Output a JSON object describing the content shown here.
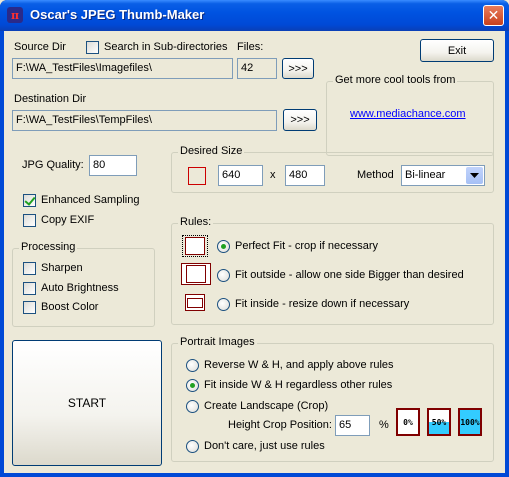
{
  "window": {
    "title": "Oscar's JPEG Thumb-Maker",
    "close_symbol": "✕"
  },
  "source": {
    "label": "Source Dir",
    "search_sub_label": "Search in Sub-directories",
    "search_sub_checked": false,
    "path": "F:\\WA_TestFiles\\Imagefiles\\",
    "files_label": "Files:",
    "files_count": "42",
    "browse_label": ">>>"
  },
  "destination": {
    "label": "Destination Dir",
    "path": "F:\\WA_TestFiles\\TempFiles\\",
    "browse_label": ">>>"
  },
  "exit_label": "Exit",
  "tools": {
    "text": "Get more cool tools from",
    "link": "www.mediachance.com"
  },
  "quality": {
    "label": "JPG Quality:",
    "value": "80"
  },
  "options": {
    "enhanced_label": "Enhanced Sampling",
    "enhanced_checked": true,
    "copy_exif_label": "Copy EXIF",
    "copy_exif_checked": false
  },
  "processing": {
    "title": "Processing",
    "sharpen_label": "Sharpen",
    "auto_brightness_label": "Auto Brightness",
    "boost_color_label": "Boost Color"
  },
  "desired_size": {
    "title": "Desired Size",
    "width": "640",
    "x_label": "x",
    "height": "480",
    "method_label": "Method",
    "method_value": "Bi-linear"
  },
  "rules": {
    "title": "Rules:",
    "items": [
      {
        "label": "Perfect Fit - crop if necessary",
        "checked": true
      },
      {
        "label": "Fit outside - allow one side Bigger than desired",
        "checked": false
      },
      {
        "label": "Fit inside - resize down if necessary",
        "checked": false
      }
    ]
  },
  "start_label": "START",
  "portrait": {
    "title": "Portrait Images",
    "items": [
      {
        "label": "Reverse W & H, and apply above rules",
        "checked": false
      },
      {
        "label": "Fit inside W & H regardless other rules",
        "checked": true
      },
      {
        "label": "Create Landscape (Crop)",
        "checked": false
      },
      {
        "label": "Don't care, just use rules",
        "checked": false
      }
    ],
    "crop_label": "Height Crop Position:",
    "crop_value": "65",
    "percent_sign": "%",
    "presets": [
      {
        "label": "0%",
        "fill": 0.0
      },
      {
        "label": "50%",
        "fill": 0.5
      },
      {
        "label": "100%",
        "fill": 1.0
      }
    ]
  },
  "colors": {
    "accent_red": "#cc0000",
    "rule_icon_border": "#800000",
    "preset_fill": "#33ccff",
    "link": "#0000ff"
  }
}
